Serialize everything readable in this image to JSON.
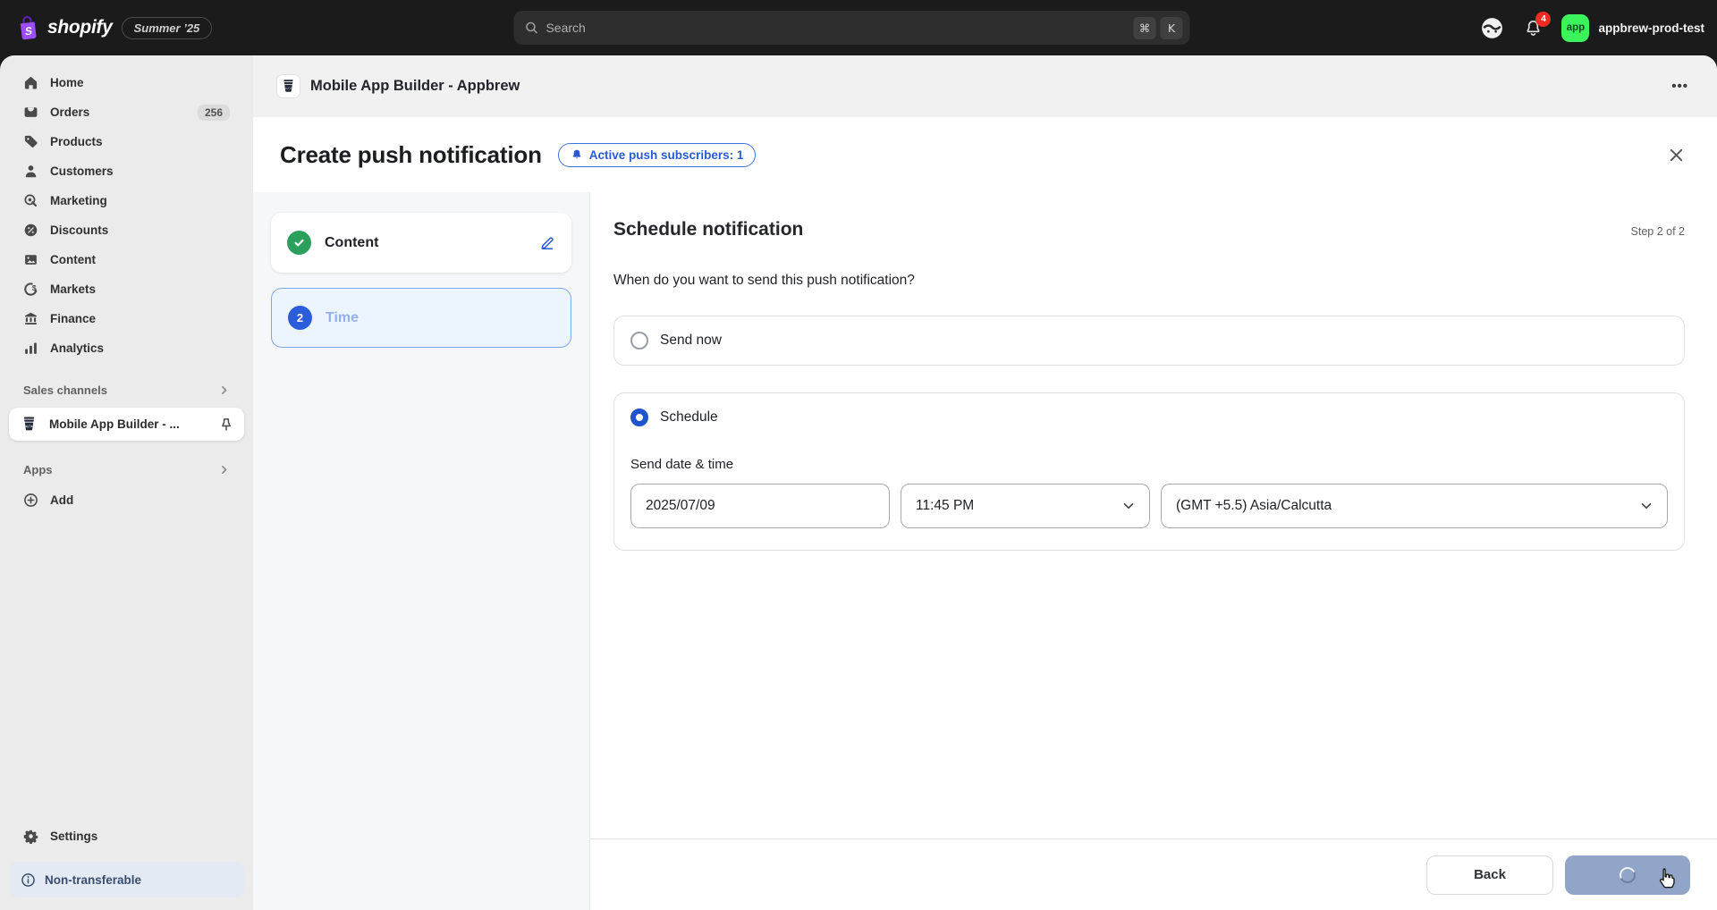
{
  "topbar": {
    "logo_text": "shopify",
    "version_badge": "Summer ’25",
    "search": {
      "placeholder": "Search",
      "key_1": "⌘",
      "key_2": "K"
    },
    "notifications_count": "4",
    "store": {
      "avatar_label": "app",
      "name": "appbrew-prod-test"
    }
  },
  "sidebar": {
    "items": [
      {
        "label": "Home"
      },
      {
        "label": "Orders",
        "badge": "256"
      },
      {
        "label": "Products"
      },
      {
        "label": "Customers"
      },
      {
        "label": "Marketing"
      },
      {
        "label": "Discounts"
      },
      {
        "label": "Content"
      },
      {
        "label": "Markets"
      },
      {
        "label": "Finance"
      },
      {
        "label": "Analytics"
      }
    ],
    "sales_channels_header": "Sales channels",
    "selected_channel": "Mobile App Builder - ...",
    "apps_header": "Apps",
    "add_label": "Add",
    "settings_label": "Settings",
    "transfer_notice": "Non-transferable"
  },
  "app_header": {
    "title": "Mobile App Builder - Appbrew",
    "menu_label": "•••"
  },
  "page": {
    "title": "Create push notification",
    "subscribers_badge": "Active push subscribers: 1"
  },
  "steps": {
    "content": {
      "label": "Content"
    },
    "time": {
      "number": "2",
      "label": "Time"
    }
  },
  "form": {
    "heading": "Schedule notification",
    "step_indicator": "Step 2 of 2",
    "question": "When do you want to send this push notification?",
    "option_send_now": "Send now",
    "option_schedule": "Schedule",
    "datetime_label": "Send date & time",
    "date_value": "2025/07/09",
    "time_value": "11:45 PM",
    "timezone_value": "(GMT +5.5) Asia/Calcutta"
  },
  "footer": {
    "back_label": "Back"
  },
  "colors": {
    "accent_blue": "#2a5bd7",
    "success_green": "#2aa05c",
    "store_green": "#3bf35b",
    "notification_red": "#ef2c23",
    "disabled_button_blue": "#91a5c9",
    "topbar_dark": "#1b1b1b",
    "sidebar_grey": "#ebebeb"
  }
}
